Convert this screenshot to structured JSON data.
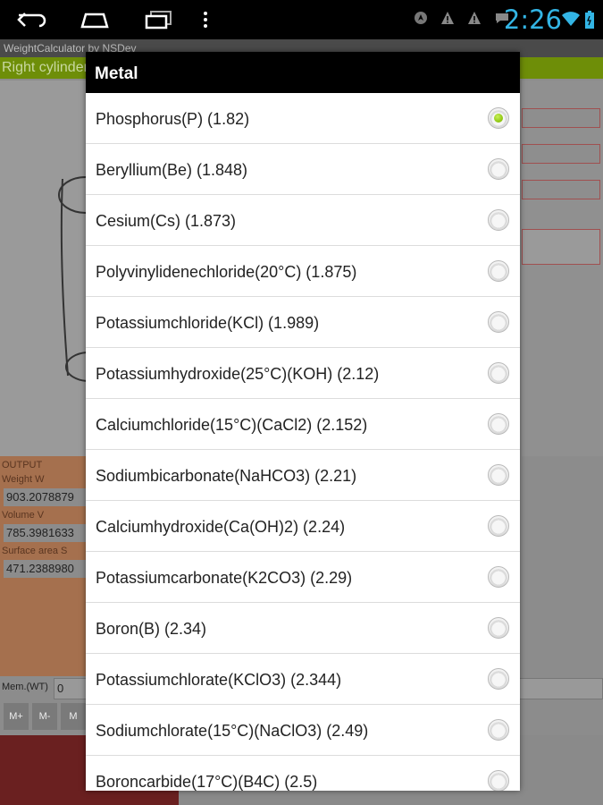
{
  "status_bar": {
    "time": "2:26",
    "nav_icons": [
      "back-icon",
      "home-icon",
      "recent-apps-icon",
      "menu-icon"
    ],
    "status_icons": [
      "location-icon",
      "warning-icon",
      "warning-icon",
      "chat-icon",
      "wifi-icon",
      "battery-icon"
    ],
    "clock_color": "#33b5e5"
  },
  "app": {
    "title": "WeightCalculator by NSDev",
    "section_header": "Right cylinder",
    "output_header": "OUTPUT",
    "outputs": [
      {
        "label": "Weight W",
        "value": "903.2078879"
      },
      {
        "label": "Volume V",
        "value": "785.3981633"
      },
      {
        "label": "Surface area S",
        "value": "471.2388980"
      }
    ],
    "memory_label": "Mem.(WT)",
    "memory_value": "0",
    "memory_buttons": [
      "M+",
      "M-",
      "M"
    ]
  },
  "dialog": {
    "title": "Metal",
    "options": [
      {
        "label": "Phosphorus(P) (1.82)",
        "checked": true
      },
      {
        "label": "Beryllium(Be) (1.848)",
        "checked": false
      },
      {
        "label": "Cesium(Cs) (1.873)",
        "checked": false
      },
      {
        "label": "Polyvinylidenechloride(20°C) (1.875)",
        "checked": false
      },
      {
        "label": "Potassiumchloride(KCl) (1.989)",
        "checked": false
      },
      {
        "label": "Potassiumhydroxide(25°C)(KOH) (2.12)",
        "checked": false
      },
      {
        "label": "Calciumchloride(15°C)(CaCl2) (2.152)",
        "checked": false
      },
      {
        "label": "Sodiumbicarbonate(NaHCO3) (2.21)",
        "checked": false
      },
      {
        "label": "Calciumhydroxide(Ca(OH)2) (2.24)",
        "checked": false
      },
      {
        "label": "Potassiumcarbonate(K2CO3) (2.29)",
        "checked": false
      },
      {
        "label": "Boron(B) (2.34)",
        "checked": false
      },
      {
        "label": "Potassiumchlorate(KClO3) (2.344)",
        "checked": false
      },
      {
        "label": "Sodiumchlorate(15°C)(NaClO3) (2.49)",
        "checked": false
      },
      {
        "label": "Boroncarbide(17°C)(B4C) (2.5)",
        "checked": false
      }
    ],
    "accent_color": "#8bc30c"
  }
}
